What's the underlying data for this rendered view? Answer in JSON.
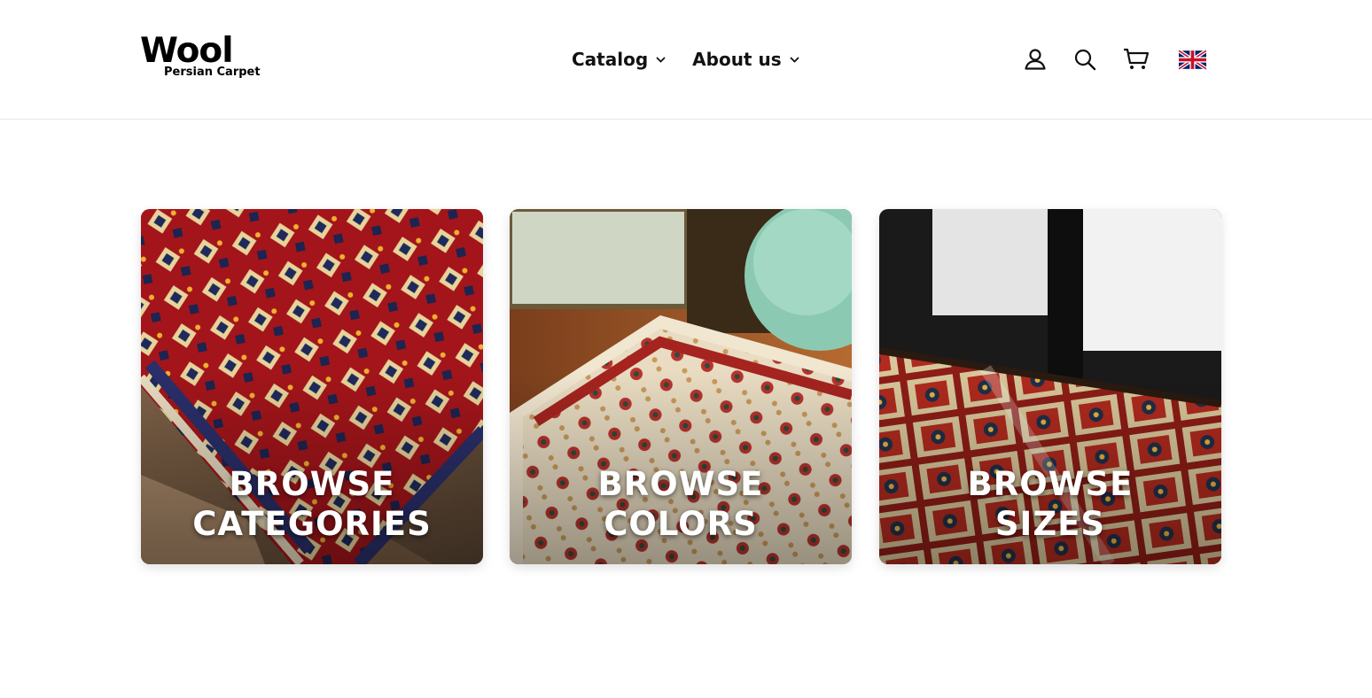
{
  "brand": {
    "name": "Wool",
    "tagline": "Persian Carpet"
  },
  "nav": {
    "items": [
      {
        "label": "Catalog"
      },
      {
        "label": "About us"
      }
    ]
  },
  "header_icons": [
    "account-icon",
    "search-icon",
    "cart-icon",
    "uk-flag-icon"
  ],
  "cards": [
    {
      "line1": "BROWSE",
      "line2": "CATEGORIES"
    },
    {
      "line1": "BROWSE",
      "line2": "COLORS"
    },
    {
      "line1": "BROWSE",
      "line2": "SIZES"
    }
  ],
  "colors": {
    "text": "#111111",
    "divider": "#e6e6e6",
    "card_text": "#ffffff"
  }
}
